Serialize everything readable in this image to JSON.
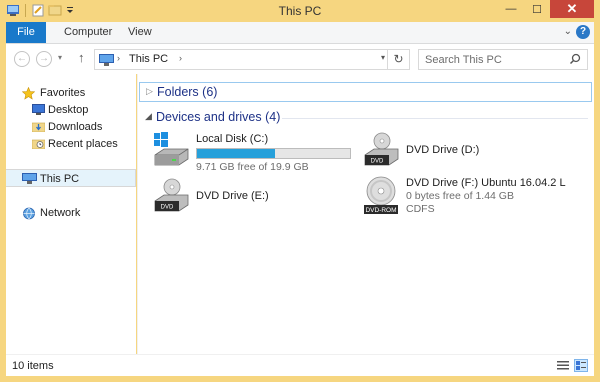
{
  "window": {
    "title": "This PC"
  },
  "quick_access": {
    "items": [
      "properties-icon",
      "new-folder-icon",
      "customize-dropdown-icon"
    ]
  },
  "window_controls": {
    "minimize": "—",
    "maximize": "☐",
    "close": "✕"
  },
  "ribbon": {
    "tabs": [
      {
        "label": "File",
        "active": true
      },
      {
        "label": "Computer"
      },
      {
        "label": "View"
      }
    ],
    "expand_glyph": "⌄",
    "help_glyph": "?"
  },
  "navigation": {
    "back_glyph": "←",
    "forward_glyph": "→",
    "recent_glyph": "▾",
    "up_glyph": "↑",
    "address": {
      "sep1": "›",
      "crumb": "This PC",
      "sep2": "›",
      "dropdown": "▾",
      "refresh_glyph": "↻"
    },
    "search": {
      "placeholder": "Search This PC"
    }
  },
  "nav_pane": {
    "favorites": "Favorites",
    "desktop": "Desktop",
    "downloads": "Downloads",
    "recent": "Recent places",
    "this_pc": "This PC",
    "network": "Network"
  },
  "content": {
    "folders_glyph": "▷",
    "folders_title": "Folders (6)",
    "devices_glyph": "◢",
    "devices_title": "Devices and drives (4)",
    "drives": [
      {
        "name": "Local Disk (C:)",
        "free_text": "9.71 GB free of 19.9 GB",
        "used_fraction": 0.51,
        "icon": "local-disk-icon"
      },
      {
        "name": "DVD Drive (D:)",
        "icon": "dvd-drive-icon"
      },
      {
        "name": "DVD Drive (E:)",
        "icon": "dvd-drive-icon"
      },
      {
        "name": "DVD Drive (F:) Ubuntu 16.04.2 L",
        "free_text": "0 bytes free of 1.44 GB",
        "filesystem": "CDFS",
        "icon": "dvd-rom-disc-icon"
      }
    ]
  },
  "status_bar": {
    "item_count": "10 items"
  },
  "colors": {
    "frame": "#f6d680",
    "file_tab": "#1979ca",
    "progress": "#26a0da",
    "group_title": "#1e3287",
    "close_button": "#c7463a"
  }
}
